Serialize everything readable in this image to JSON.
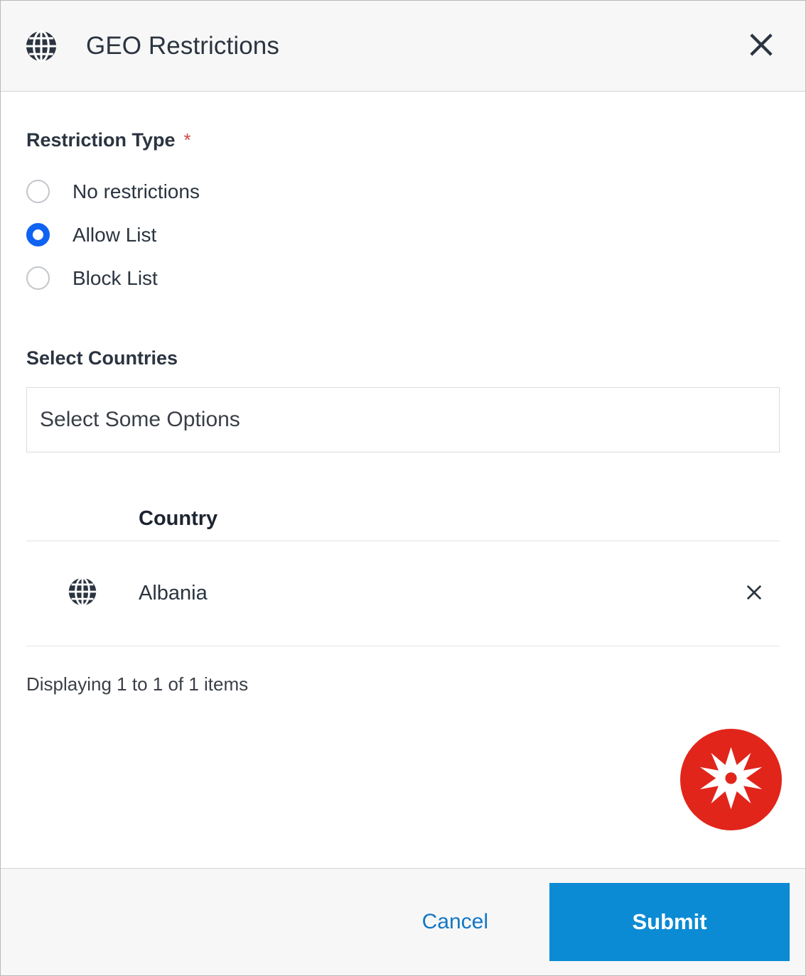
{
  "dialog": {
    "title": "GEO Restrictions",
    "title_icon": "globe-icon",
    "close_icon": "close-icon"
  },
  "restriction_type": {
    "label": "Restriction Type",
    "required_marker": "*",
    "required_color": "#cf4a4a",
    "selected": "Allow List",
    "options": [
      {
        "label": "No restrictions",
        "selected": false
      },
      {
        "label": "Allow List",
        "selected": true
      },
      {
        "label": "Block List",
        "selected": false
      }
    ]
  },
  "select_countries": {
    "label": "Select Countries",
    "placeholder": "Select Some Options",
    "value": ""
  },
  "country_table": {
    "columns": [
      "",
      "Country",
      ""
    ],
    "header": "Country",
    "rows": [
      {
        "icon": "globe-icon",
        "country": "Albania",
        "remove_icon": "close-icon"
      }
    ],
    "status": "Displaying 1 to 1 of 1 items"
  },
  "brand_badge": {
    "icon": "asterisk-starburst-icon",
    "background": "#e1251b",
    "foreground": "#ffffff"
  },
  "footer": {
    "cancel_label": "Cancel",
    "submit_label": "Submit",
    "cancel_color": "#1277c4",
    "submit_color": "#0b8bd4"
  }
}
